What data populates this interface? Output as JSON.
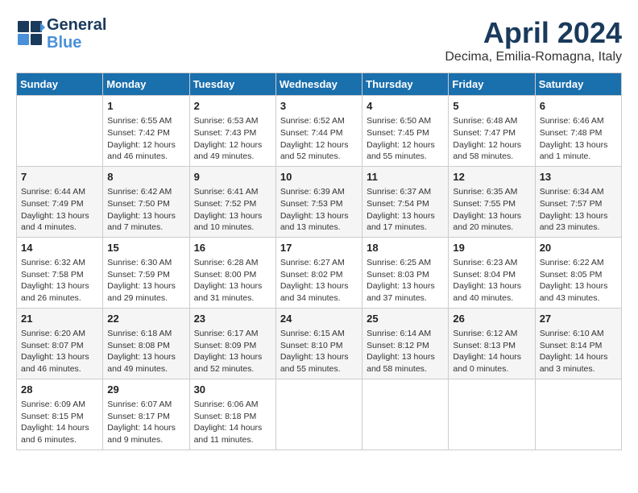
{
  "header": {
    "logo_general": "General",
    "logo_blue": "Blue",
    "month_year": "April 2024",
    "location": "Decima, Emilia-Romagna, Italy"
  },
  "weekdays": [
    "Sunday",
    "Monday",
    "Tuesday",
    "Wednesday",
    "Thursday",
    "Friday",
    "Saturday"
  ],
  "weeks": [
    [
      {
        "day": "",
        "info": ""
      },
      {
        "day": "1",
        "info": "Sunrise: 6:55 AM\nSunset: 7:42 PM\nDaylight: 12 hours\nand 46 minutes."
      },
      {
        "day": "2",
        "info": "Sunrise: 6:53 AM\nSunset: 7:43 PM\nDaylight: 12 hours\nand 49 minutes."
      },
      {
        "day": "3",
        "info": "Sunrise: 6:52 AM\nSunset: 7:44 PM\nDaylight: 12 hours\nand 52 minutes."
      },
      {
        "day": "4",
        "info": "Sunrise: 6:50 AM\nSunset: 7:45 PM\nDaylight: 12 hours\nand 55 minutes."
      },
      {
        "day": "5",
        "info": "Sunrise: 6:48 AM\nSunset: 7:47 PM\nDaylight: 12 hours\nand 58 minutes."
      },
      {
        "day": "6",
        "info": "Sunrise: 6:46 AM\nSunset: 7:48 PM\nDaylight: 13 hours\nand 1 minute."
      }
    ],
    [
      {
        "day": "7",
        "info": "Sunrise: 6:44 AM\nSunset: 7:49 PM\nDaylight: 13 hours\nand 4 minutes."
      },
      {
        "day": "8",
        "info": "Sunrise: 6:42 AM\nSunset: 7:50 PM\nDaylight: 13 hours\nand 7 minutes."
      },
      {
        "day": "9",
        "info": "Sunrise: 6:41 AM\nSunset: 7:52 PM\nDaylight: 13 hours\nand 10 minutes."
      },
      {
        "day": "10",
        "info": "Sunrise: 6:39 AM\nSunset: 7:53 PM\nDaylight: 13 hours\nand 13 minutes."
      },
      {
        "day": "11",
        "info": "Sunrise: 6:37 AM\nSunset: 7:54 PM\nDaylight: 13 hours\nand 17 minutes."
      },
      {
        "day": "12",
        "info": "Sunrise: 6:35 AM\nSunset: 7:55 PM\nDaylight: 13 hours\nand 20 minutes."
      },
      {
        "day": "13",
        "info": "Sunrise: 6:34 AM\nSunset: 7:57 PM\nDaylight: 13 hours\nand 23 minutes."
      }
    ],
    [
      {
        "day": "14",
        "info": "Sunrise: 6:32 AM\nSunset: 7:58 PM\nDaylight: 13 hours\nand 26 minutes."
      },
      {
        "day": "15",
        "info": "Sunrise: 6:30 AM\nSunset: 7:59 PM\nDaylight: 13 hours\nand 29 minutes."
      },
      {
        "day": "16",
        "info": "Sunrise: 6:28 AM\nSunset: 8:00 PM\nDaylight: 13 hours\nand 31 minutes."
      },
      {
        "day": "17",
        "info": "Sunrise: 6:27 AM\nSunset: 8:02 PM\nDaylight: 13 hours\nand 34 minutes."
      },
      {
        "day": "18",
        "info": "Sunrise: 6:25 AM\nSunset: 8:03 PM\nDaylight: 13 hours\nand 37 minutes."
      },
      {
        "day": "19",
        "info": "Sunrise: 6:23 AM\nSunset: 8:04 PM\nDaylight: 13 hours\nand 40 minutes."
      },
      {
        "day": "20",
        "info": "Sunrise: 6:22 AM\nSunset: 8:05 PM\nDaylight: 13 hours\nand 43 minutes."
      }
    ],
    [
      {
        "day": "21",
        "info": "Sunrise: 6:20 AM\nSunset: 8:07 PM\nDaylight: 13 hours\nand 46 minutes."
      },
      {
        "day": "22",
        "info": "Sunrise: 6:18 AM\nSunset: 8:08 PM\nDaylight: 13 hours\nand 49 minutes."
      },
      {
        "day": "23",
        "info": "Sunrise: 6:17 AM\nSunset: 8:09 PM\nDaylight: 13 hours\nand 52 minutes."
      },
      {
        "day": "24",
        "info": "Sunrise: 6:15 AM\nSunset: 8:10 PM\nDaylight: 13 hours\nand 55 minutes."
      },
      {
        "day": "25",
        "info": "Sunrise: 6:14 AM\nSunset: 8:12 PM\nDaylight: 13 hours\nand 58 minutes."
      },
      {
        "day": "26",
        "info": "Sunrise: 6:12 AM\nSunset: 8:13 PM\nDaylight: 14 hours\nand 0 minutes."
      },
      {
        "day": "27",
        "info": "Sunrise: 6:10 AM\nSunset: 8:14 PM\nDaylight: 14 hours\nand 3 minutes."
      }
    ],
    [
      {
        "day": "28",
        "info": "Sunrise: 6:09 AM\nSunset: 8:15 PM\nDaylight: 14 hours\nand 6 minutes."
      },
      {
        "day": "29",
        "info": "Sunrise: 6:07 AM\nSunset: 8:17 PM\nDaylight: 14 hours\nand 9 minutes."
      },
      {
        "day": "30",
        "info": "Sunrise: 6:06 AM\nSunset: 8:18 PM\nDaylight: 14 hours\nand 11 minutes."
      },
      {
        "day": "",
        "info": ""
      },
      {
        "day": "",
        "info": ""
      },
      {
        "day": "",
        "info": ""
      },
      {
        "day": "",
        "info": ""
      }
    ]
  ]
}
